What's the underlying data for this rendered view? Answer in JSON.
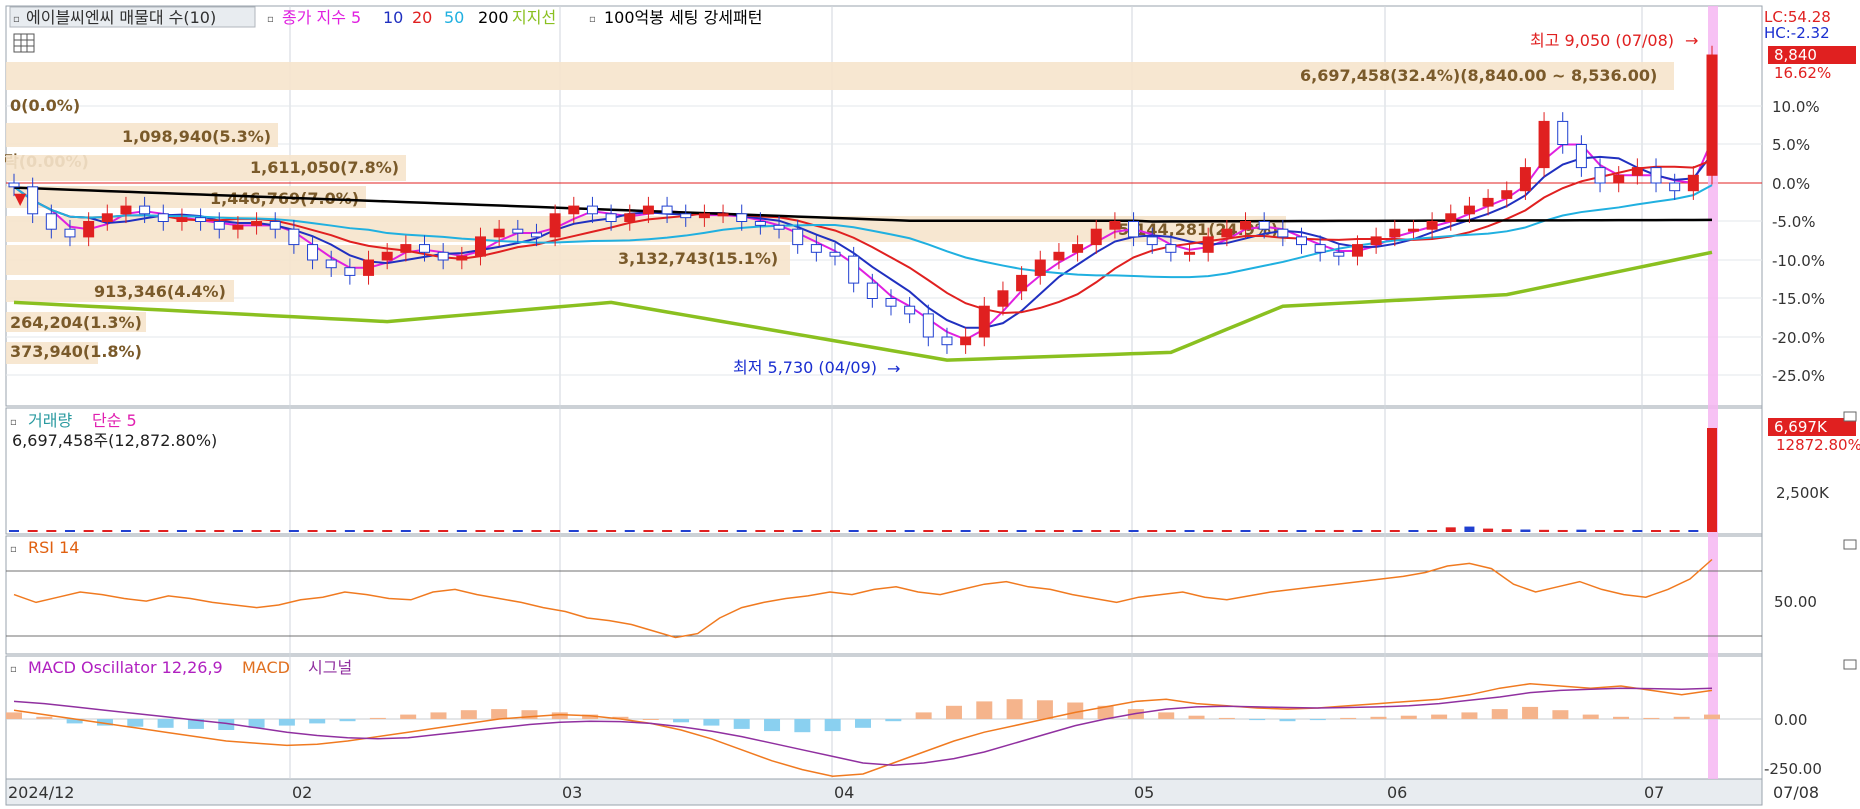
{
  "header": {
    "title": "에이블씨엔씨 매물대 수(10)",
    "legend": [
      {
        "text": "종가 지수 5",
        "color": "#e020e0"
      },
      {
        "text": "10",
        "color": "#2030c0"
      },
      {
        "text": "20",
        "color": "#e02020"
      },
      {
        "text": "50",
        "color": "#20b0e0"
      },
      {
        "text": "200",
        "color": "#000000"
      },
      {
        "text": "지지선",
        "color": "#8ac020"
      },
      {
        "text": "100억봉 세팅 강세패턴",
        "color": "#000000"
      }
    ]
  },
  "corner": {
    "lc": "LC:54.28",
    "hc": "HC:-2.32"
  },
  "price_panel": {
    "high_note": "최고 9,050 (07/08)",
    "low_note": "최저 5,730 (04/09)",
    "current_badge": "8,840",
    "current_pct": "16.62%",
    "yticks": [
      "10.0%",
      "5.0%",
      "0.0%",
      "-5.0%",
      "-10.0%",
      "-15.0%",
      "-20.0%",
      "-25.0%"
    ]
  },
  "volume_profile": [
    {
      "text": "6,697,458(32.4%)(8,840.00 ~ 8,536.00)"
    },
    {
      "text": "0(0.0%)"
    },
    {
      "text": "1,098,940(5.3%)"
    },
    {
      "text": "락(0.00%)"
    },
    {
      "text": "1,611,050(7.8%)"
    },
    {
      "text": "1,446,769(7.0%)"
    },
    {
      "text": "5,144,281(24.9%)"
    },
    {
      "text": "3,132,743(15.1%)"
    },
    {
      "text": "913,346(4.4%)"
    },
    {
      "text": "264,204(1.3%)"
    },
    {
      "text": "373,940(1.8%)"
    }
  ],
  "volume_panel": {
    "title": "거래량",
    "ma": "단순 5",
    "value_text": "6,697,458주(12,872.80%)",
    "badge": "6,697K",
    "badge2": "12872.80%",
    "ytick": "2,500K"
  },
  "rsi_panel": {
    "title": "RSI 14",
    "ytick": "50.00"
  },
  "macd_panel": {
    "title": "MACD Oscillator 12,26,9",
    "macd": "MACD",
    "signal": "시그널",
    "yticks": [
      "0.00",
      "-250.00"
    ]
  },
  "xaxis": {
    "labels": [
      "2024/12",
      "02",
      "03",
      "04",
      "05",
      "06",
      "07"
    ],
    "right_label": "07/08"
  },
  "chart_data": {
    "type": "candlestick",
    "ylabel_unit": "% change",
    "ylim": [
      -27,
      15
    ],
    "reference_price": 7580,
    "high": {
      "date": "07/08",
      "value": 9050
    },
    "low": {
      "date": "04/09",
      "value": 5730
    },
    "close_series_pct": [
      -0.5,
      -4,
      -6,
      -7,
      -5,
      -4,
      -3,
      -4,
      -5,
      -4.5,
      -5,
      -6,
      -5.5,
      -5,
      -6,
      -8,
      -10,
      -11,
      -12,
      -10,
      -9,
      -8,
      -9,
      -10,
      -9.5,
      -7,
      -6,
      -6.5,
      -7,
      -4,
      -3,
      -4,
      -5,
      -4,
      -3,
      -4,
      -4.5,
      -4,
      -4,
      -5,
      -5.5,
      -6,
      -8,
      -9,
      -9.5,
      -13,
      -15,
      -16,
      -17,
      -20,
      -21,
      -20,
      -16,
      -14,
      -12,
      -10,
      -9,
      -8,
      -6,
      -5,
      -7,
      -8,
      -9,
      -9,
      -7,
      -6,
      -5,
      -6,
      -7,
      -8,
      -9,
      -9.5,
      -8,
      -7,
      -6,
      -6,
      -5,
      -4,
      -3,
      -2,
      -1,
      2,
      8,
      5,
      2,
      0,
      1,
      2,
      0,
      -1,
      1,
      16.62
    ],
    "volume_series_k": [
      60,
      50,
      55,
      40,
      45,
      50,
      60,
      45,
      50,
      40,
      55,
      45,
      50,
      60,
      80,
      90,
      70,
      60,
      50,
      45,
      60,
      80,
      100,
      90,
      80,
      70,
      60,
      80,
      70,
      60,
      50,
      60,
      70,
      80,
      90,
      80,
      70,
      60,
      60,
      70,
      80,
      90,
      100,
      110,
      120,
      110,
      100,
      90,
      80,
      70,
      90,
      100,
      110,
      120,
      100,
      90,
      80,
      70,
      80,
      90,
      100,
      90,
      80,
      70,
      60,
      70,
      80,
      90,
      100,
      110,
      120,
      130,
      120,
      110,
      100,
      90,
      120,
      300,
      350,
      220,
      180,
      160,
      140,
      130,
      150,
      120,
      100,
      90,
      100,
      110,
      120,
      6697
    ],
    "rsi_series": [
      58,
      52,
      56,
      60,
      58,
      55,
      53,
      57,
      55,
      52,
      50,
      48,
      50,
      54,
      56,
      60,
      58,
      55,
      54,
      60,
      62,
      58,
      55,
      52,
      48,
      45,
      40,
      38,
      35,
      30,
      25,
      28,
      40,
      48,
      52,
      55,
      57,
      60,
      58,
      62,
      64,
      60,
      58,
      62,
      66,
      68,
      64,
      62,
      58,
      55,
      52,
      56,
      58,
      60,
      56,
      54,
      57,
      60,
      62,
      64,
      66,
      68,
      70,
      72,
      75,
      80,
      82,
      78,
      66,
      60,
      64,
      68,
      62,
      58,
      56,
      62,
      70,
      85
    ],
    "macd_series": [
      40,
      20,
      0,
      -20,
      -40,
      -60,
      -80,
      -100,
      -110,
      -120,
      -115,
      -100,
      -80,
      -60,
      -40,
      -20,
      0,
      10,
      20,
      15,
      0,
      -20,
      -50,
      -90,
      -140,
      -190,
      -230,
      -260,
      -250,
      -200,
      -150,
      -100,
      -60,
      -30,
      0,
      30,
      55,
      80,
      90,
      70,
      60,
      50,
      45,
      50,
      60,
      70,
      80,
      90,
      110,
      140,
      160,
      150,
      140,
      150,
      130,
      110,
      130
    ],
    "signal_series": [
      80,
      70,
      55,
      40,
      25,
      10,
      -5,
      -20,
      -40,
      -60,
      -75,
      -85,
      -90,
      -85,
      -70,
      -55,
      -40,
      -25,
      -15,
      -10,
      -12,
      -20,
      -35,
      -55,
      -80,
      -110,
      -140,
      -170,
      -200,
      -210,
      -200,
      -180,
      -150,
      -110,
      -70,
      -30,
      0,
      25,
      45,
      55,
      58,
      55,
      52,
      50,
      52,
      55,
      60,
      70,
      85,
      100,
      120,
      130,
      135,
      140,
      138,
      135,
      140
    ],
    "oscillator_series": [
      30,
      10,
      -20,
      -30,
      -35,
      -40,
      -45,
      -50,
      -40,
      -30,
      -20,
      -10,
      5,
      20,
      30,
      40,
      45,
      40,
      30,
      20,
      10,
      0,
      -15,
      -30,
      -45,
      -55,
      -60,
      -55,
      -40,
      -10,
      30,
      60,
      80,
      90,
      85,
      75,
      60,
      45,
      30,
      15,
      5,
      -5,
      -10,
      -5,
      5,
      10,
      15,
      20,
      30,
      45,
      55,
      40,
      20,
      10,
      5,
      10,
      20
    ]
  }
}
